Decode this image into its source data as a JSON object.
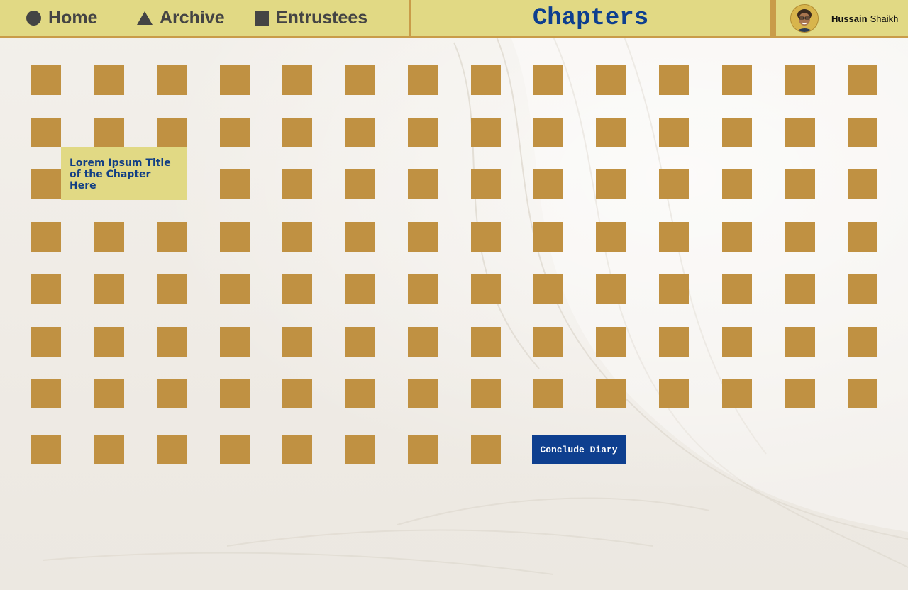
{
  "nav": {
    "items": [
      {
        "label": "Home",
        "icon": "circle-icon"
      },
      {
        "label": "Archive",
        "icon": "triangle-icon"
      },
      {
        "label": "Entrustees",
        "icon": "square-icon"
      }
    ]
  },
  "header": {
    "title": "Chapters"
  },
  "user": {
    "first_name": "Hussain",
    "last_name": "Shaikh",
    "avatar_icon": "user-avatar"
  },
  "chapters": {
    "total": 108,
    "active_index": 30,
    "tooltip": "Lorem Ipsum Title of the Chapter Here"
  },
  "actions": {
    "conclude_label": "Conclude Diary"
  },
  "colors": {
    "topbar": "#e1d984",
    "accent_border": "#c99c49",
    "tile": "#c09142",
    "tile_active": "#3a7be0",
    "title_text": "#0e3f8f",
    "button": "#0e3f8f",
    "nav_text": "#444444"
  }
}
